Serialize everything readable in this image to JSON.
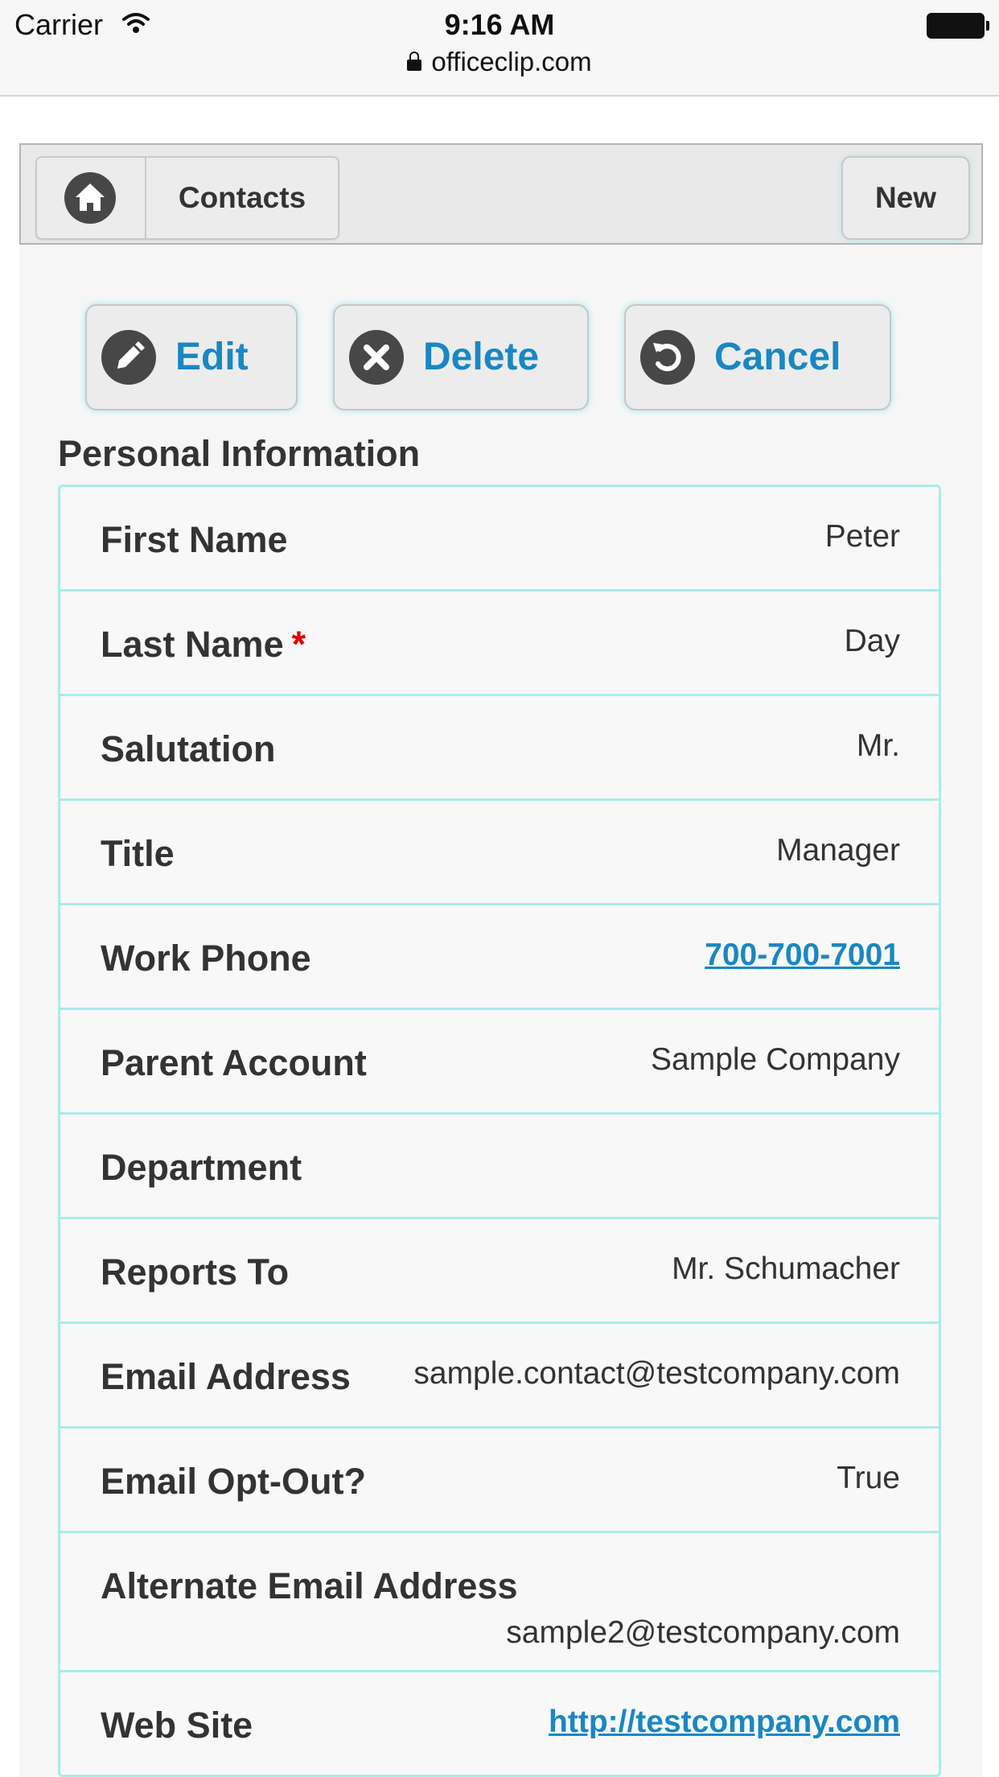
{
  "status_bar": {
    "carrier": "Carrier",
    "time": "9:16 AM",
    "url": "officeclip.com"
  },
  "header": {
    "breadcrumb": "Contacts",
    "new_label": "New"
  },
  "actions": {
    "edit": "Edit",
    "delete": "Delete",
    "cancel": "Cancel"
  },
  "section": {
    "title": "Personal Information",
    "required_mark": "*",
    "fields": [
      {
        "label": "First Name",
        "value": "Peter"
      },
      {
        "label": "Last Name",
        "value": "Day"
      },
      {
        "label": "Salutation",
        "value": "Mr."
      },
      {
        "label": "Title",
        "value": "Manager"
      },
      {
        "label": "Work Phone",
        "value": "700-700-7001"
      },
      {
        "label": "Parent Account",
        "value": "Sample Company"
      },
      {
        "label": "Department",
        "value": ""
      },
      {
        "label": "Reports To",
        "value": "Mr. Schumacher"
      },
      {
        "label": "Email Address",
        "value": "sample.contact@testcompany.com"
      },
      {
        "label": "Email Opt-Out?",
        "value": "True"
      },
      {
        "label": "Alternate Email Address",
        "value": "sample2@testcompany.com"
      },
      {
        "label": "Web Site",
        "value": "http://testcompany.com"
      }
    ]
  },
  "colors": {
    "accent": "#1a87c2",
    "row_border": "#a8ecec",
    "required": "#e00000",
    "icon_fill": "#474747"
  },
  "icons": [
    "wifi-icon",
    "battery-icon",
    "lock-icon",
    "home-icon",
    "pencil-icon",
    "close-circle-icon",
    "undo-icon"
  ]
}
